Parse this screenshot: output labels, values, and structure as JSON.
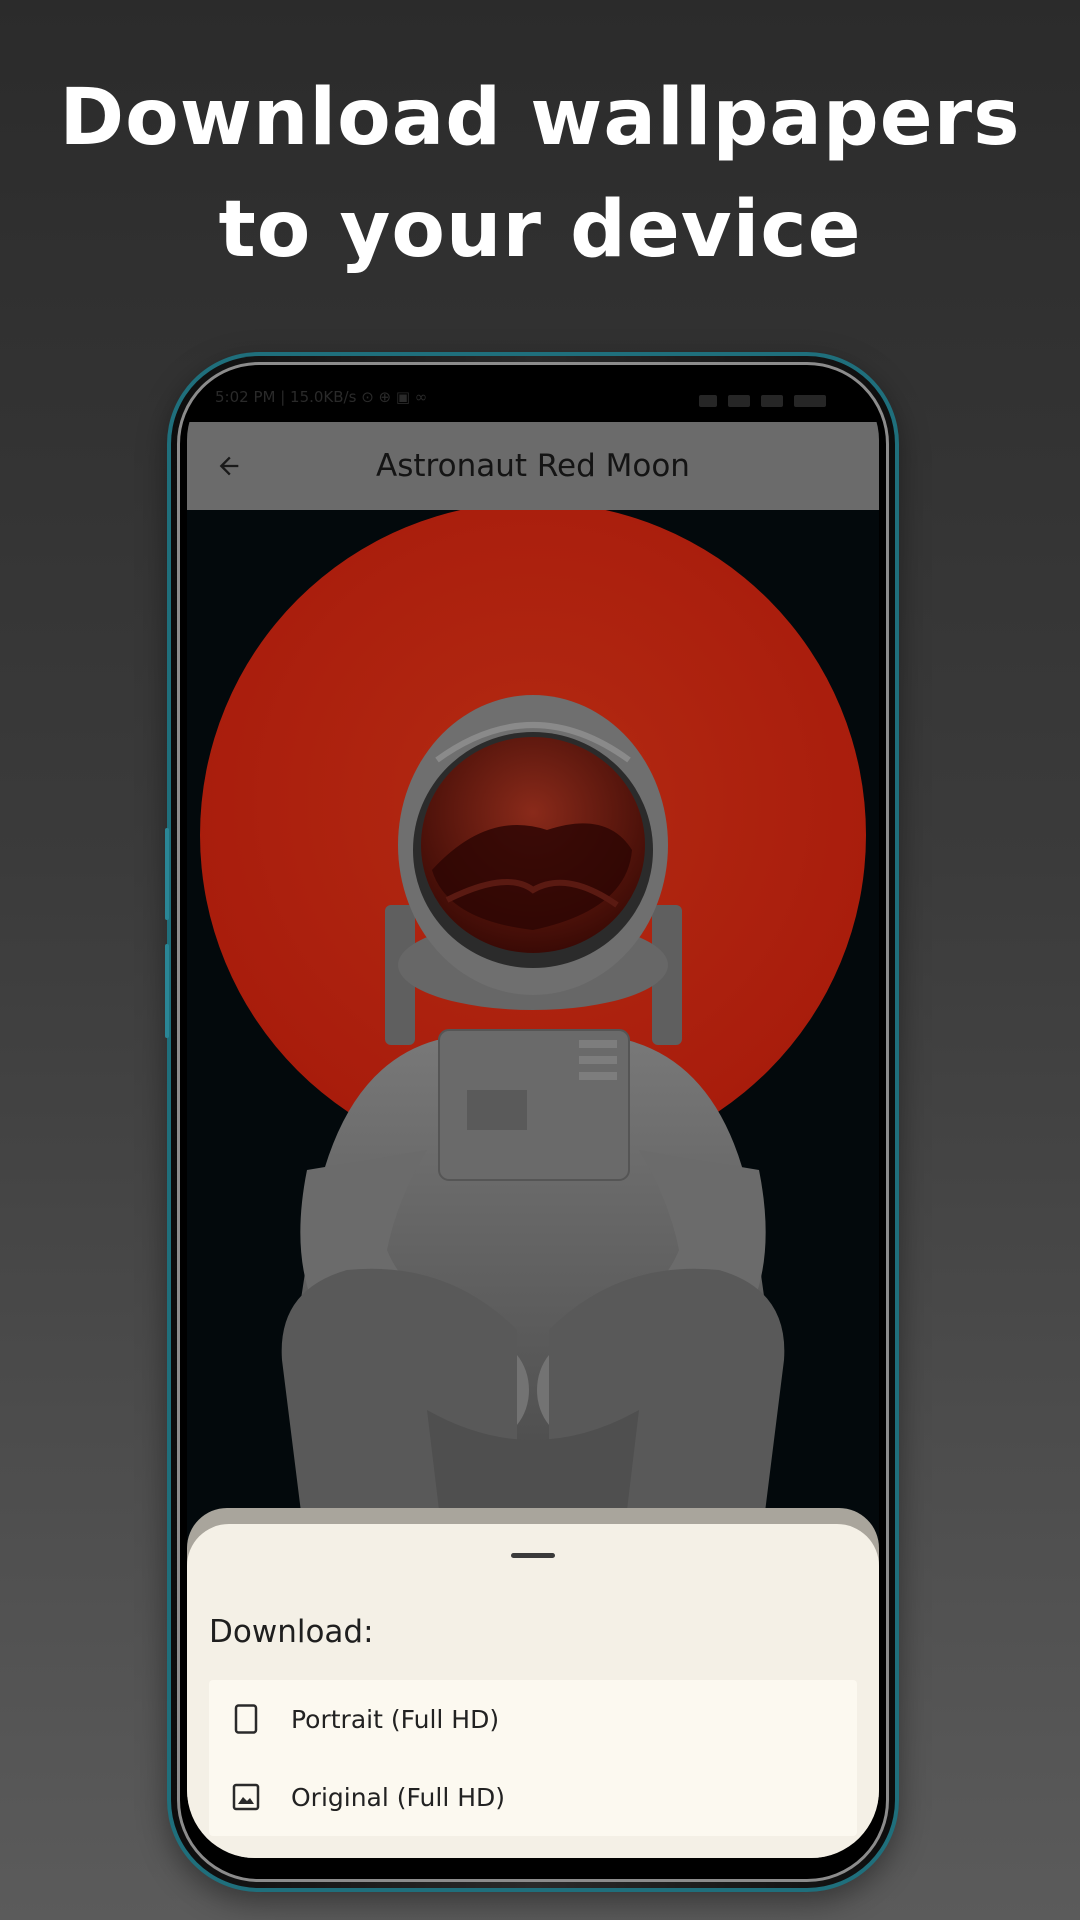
{
  "headline": {
    "line1": "Download wallpapers",
    "line2": "to your device"
  },
  "status_bar": {
    "left_text": "5:02 PM | 15.0KB/s ⊙ ⊕ ▣ ∞",
    "right_text": "…"
  },
  "app_bar": {
    "back_icon": "arrow-left-icon",
    "title": "Astronaut Red Moon"
  },
  "wallpaper": {
    "subject": "astronaut-red-moon-image",
    "moon_color": "#b8230f",
    "background_color": "#03090c",
    "suit_color": "#6e6e6e"
  },
  "bottom_sheet": {
    "title": "Download:",
    "options": [
      {
        "icon": "portrait-phone-icon",
        "label": "Portrait (Full HD)"
      },
      {
        "icon": "image-icon",
        "label": "Original (Full HD)"
      }
    ]
  },
  "colors": {
    "app_bar_bg": "#6b6b6b",
    "sheet_bg": "#f4f0e6",
    "phone_accent": "#1f6f7c"
  }
}
